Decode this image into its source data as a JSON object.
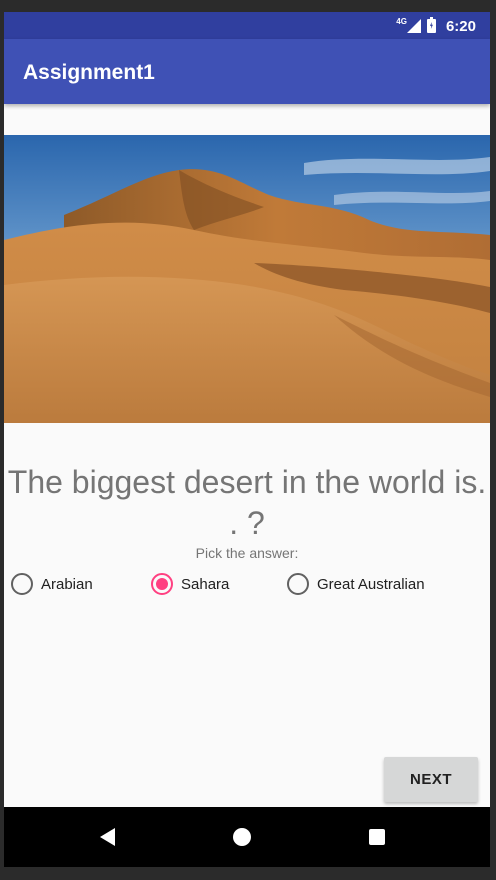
{
  "status_bar": {
    "network": "4G",
    "time": "6:20",
    "background_color": "#303f9f"
  },
  "app_bar": {
    "title": "Assignment1",
    "background_color": "#3f51b5"
  },
  "hero_image": {
    "subject": "sand dunes under a blue sky"
  },
  "question": {
    "text": "The biggest desert in the world is. . ?",
    "prompt": "Pick the answer:"
  },
  "answers": {
    "options": [
      {
        "label": "Arabian",
        "selected": false
      },
      {
        "label": "Sahara",
        "selected": true
      },
      {
        "label": "Great Australian",
        "selected": false
      }
    ],
    "accent_color": "#ff4081"
  },
  "actions": {
    "next_label": "NEXT"
  },
  "nav_bar": {
    "icons": [
      "back-icon",
      "home-icon",
      "recents-icon"
    ]
  }
}
